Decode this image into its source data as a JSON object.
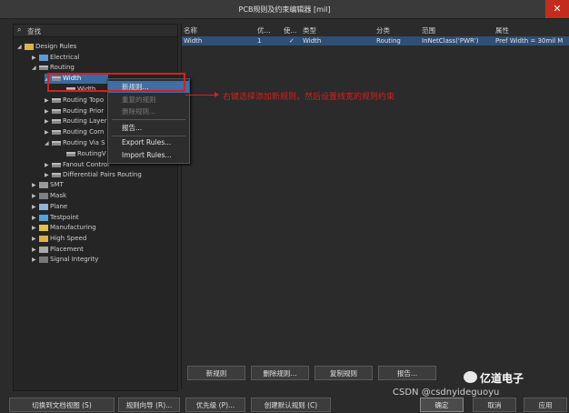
{
  "window": {
    "title": "PCB规则及约束编辑器 [mil]",
    "close_glyph": "✕"
  },
  "search": {
    "label": "查找"
  },
  "tree": {
    "design_rules": "Design Rules",
    "electrical": "Electrical",
    "routing": "Routing",
    "width": "Width",
    "width_child": "Width",
    "routing_topo": "Routing Topo",
    "routing_prior": "Routing Prior",
    "routing_layer": "Routing Layer",
    "routing_corn": "Routing Corn",
    "routing_via": "Routing Via S",
    "routing_via_child": "RoutingV",
    "fanout": "Fanout Control",
    "diff_pairs": "Differential Pairs Routing",
    "smt": "SMT",
    "mask": "Mask",
    "plane": "Plane",
    "testpoint": "Testpoint",
    "manufacturing": "Manufacturing",
    "high_speed": "High Speed",
    "placement": "Placement",
    "signal_integrity": "Signal Integrity"
  },
  "table": {
    "headers": {
      "name": "名称",
      "priority": "优...",
      "enabled": "使...",
      "type": "类型",
      "category": "分类",
      "scope": "范围",
      "attributes": "属性"
    },
    "row": {
      "name": "Width",
      "priority": "1",
      "enabled": "✓",
      "type": "Width",
      "category": "Routing",
      "scope": "InNetClass('PWR')",
      "attributes": "Pref Width = 30mil  M"
    }
  },
  "context_menu": {
    "new_rule": "新规则...",
    "duplicate": "重复的规则",
    "delete": "删除规则...",
    "report": "报告...",
    "export": "Export Rules...",
    "import": "Import Rules..."
  },
  "annotation": {
    "text": "右键选择添加新规则，然后设置线宽的规则约束"
  },
  "right_buttons": {
    "new_rule": "新规则",
    "delete_rule": "删除规则...",
    "copy_rule": "复制规则",
    "report": "报告..."
  },
  "bottom_buttons": {
    "switch_view": "切换到文档视图 (S)",
    "rule_wizard": "规则向导 (R)...",
    "priority": "优先级 (P)...",
    "create_default": "创建默认规则 (C)",
    "ok": "确定",
    "cancel": "取消",
    "apply": "应用"
  },
  "watermark": {
    "brand": "亿道电子",
    "csdn": "CSDN @csdnyideguoyu"
  },
  "colors": {
    "annotation": "#d42020",
    "selection": "#3d6a9e",
    "close": "#c42b1c"
  }
}
